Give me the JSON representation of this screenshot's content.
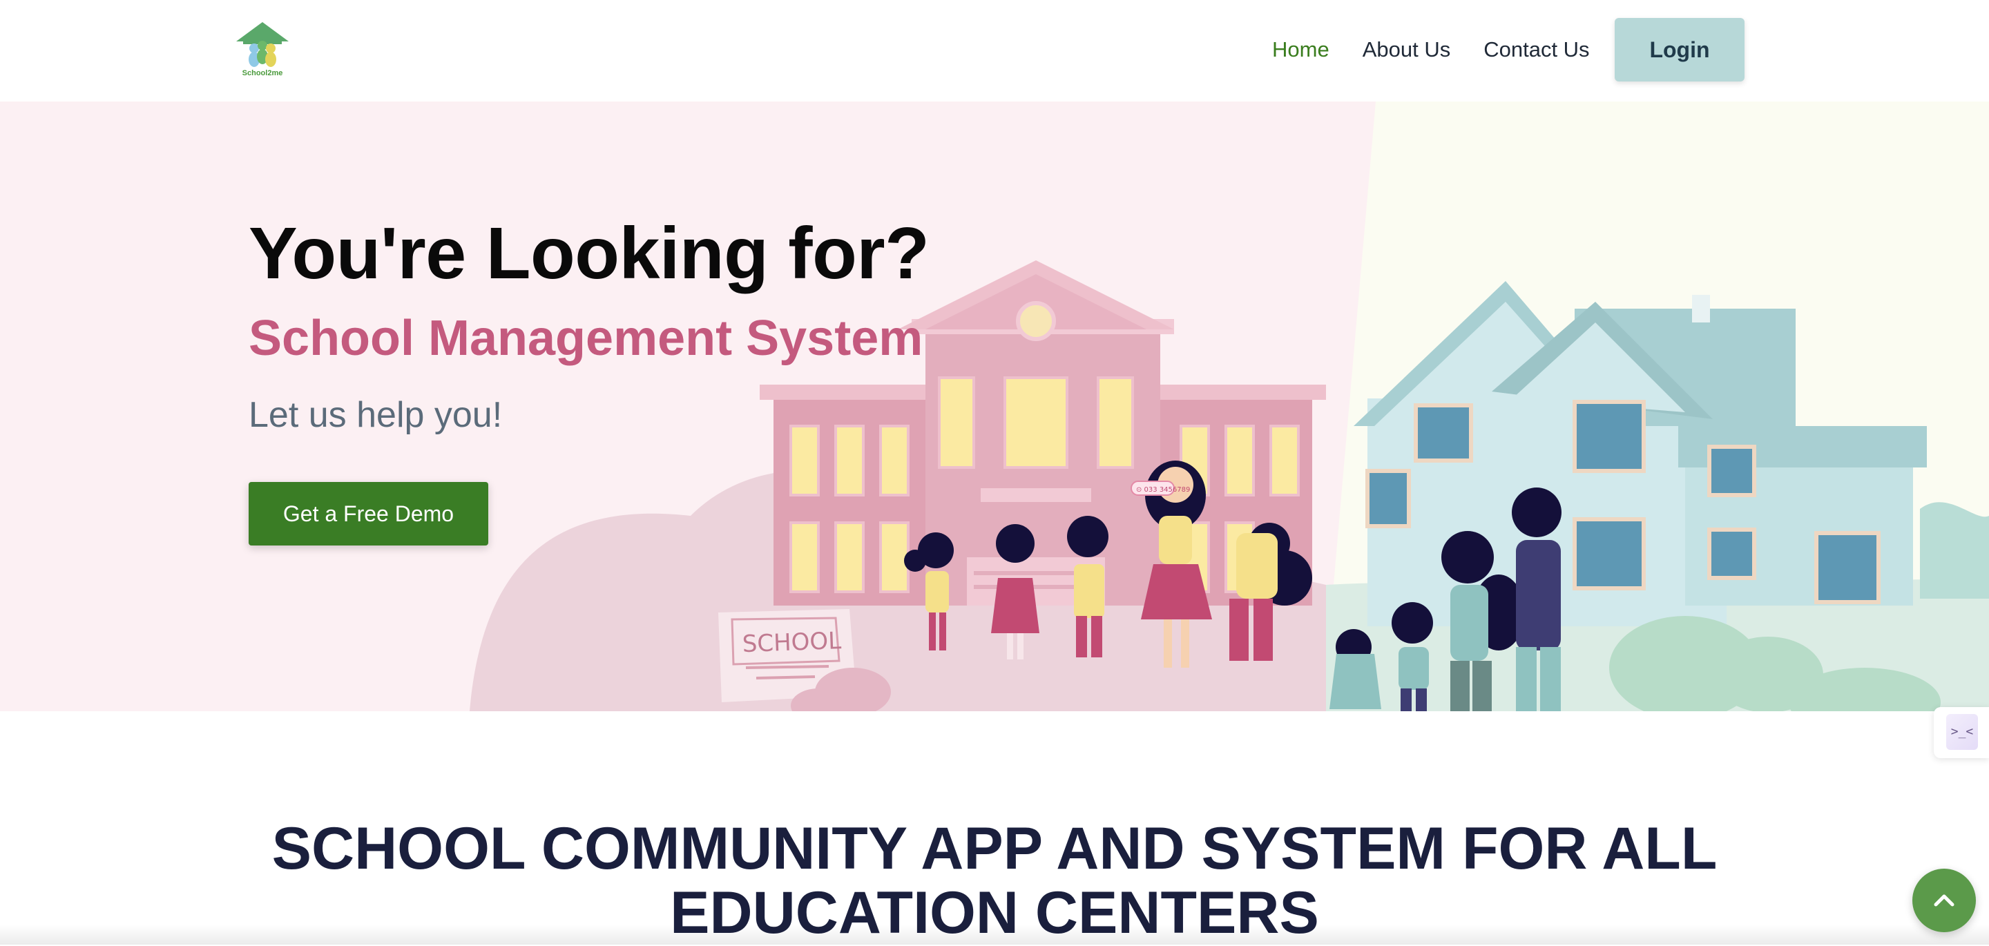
{
  "brand": {
    "logo_text": "School2me"
  },
  "nav": {
    "items": [
      {
        "label": "Home",
        "active": true
      },
      {
        "label": "About Us",
        "active": false
      },
      {
        "label": "Contact Us",
        "active": false
      }
    ],
    "login_label": "Login"
  },
  "hero": {
    "title": "You're Looking for?",
    "subtitle": "School Management System",
    "tagline": "Let us help you!",
    "cta_label": "Get a Free Demo",
    "illustration": {
      "school_sign": "SCHOOL",
      "phone_label": "⊙ 033 3456789"
    }
  },
  "section": {
    "heading_line1": "SCHOOL COMMUNITY APP AND SYSTEM FOR ALL",
    "heading_line2": "EDUCATION CENTERS"
  },
  "widgets": {
    "side_widget_glyph": ">_<",
    "scroll_top_icon": "chevron-up-icon"
  },
  "colors": {
    "accent_green": "#3a7d25",
    "nav_active": "#3a7d1e",
    "subtitle_pink": "#c45a7e",
    "hero_pink_bg": "#fcf0f3",
    "hero_cream_bg": "#fbfcf2",
    "login_bg": "#b7d8d8",
    "heading_navy": "#1a1f3d"
  }
}
